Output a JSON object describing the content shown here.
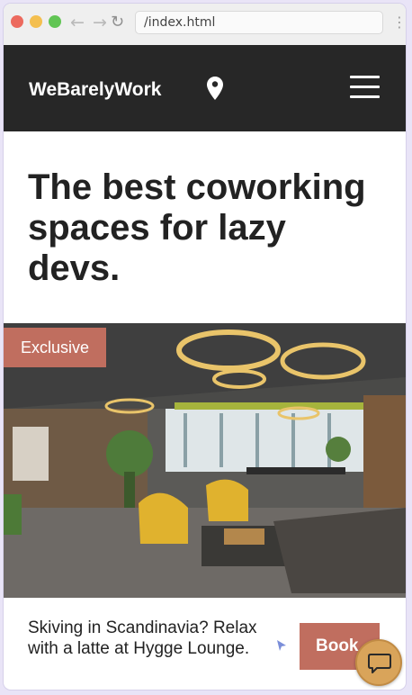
{
  "browser": {
    "url": "/index.html",
    "back_glyph": "←",
    "forward_glyph": "→",
    "reload_glyph": "↻",
    "menu_glyph": "⋮"
  },
  "header": {
    "brand": "WeBarelyWork",
    "location_icon": "map-pin-icon",
    "menu_icon": "hamburger-menu-icon"
  },
  "hero": {
    "title": "The best coworking spaces for lazy devs."
  },
  "featured": {
    "badge": "Exclusive",
    "image": "coworking-space-photo"
  },
  "promo": {
    "text": "Skiving in Scandinavia? Relax with a latte at Hygge Lounge.",
    "button_label": "Book"
  },
  "chat": {
    "icon": "chat-bubble-icon"
  },
  "colors": {
    "header_bg": "#272727",
    "accent": "#c06e5f",
    "chat_bg": "#d9a45a"
  }
}
